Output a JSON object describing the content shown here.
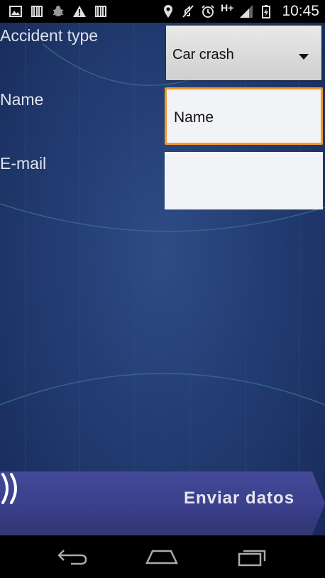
{
  "status_bar": {
    "time": "10:45",
    "network_type": "H+",
    "left_icons": [
      "image-icon",
      "barcode-icon",
      "bug-icon",
      "warning-icon",
      "barcode-icon"
    ],
    "right_icons": [
      "location-icon",
      "mute-icon",
      "alarm-icon",
      "signal-icon",
      "battery-icon"
    ]
  },
  "form": {
    "accident_type_label": "Accident type",
    "accident_type_value": "Car crash",
    "name_label": "Name",
    "name_value": "Name",
    "email_label": "E-mail",
    "email_value": ""
  },
  "send_button": {
    "label": "Enviar datos"
  },
  "nav_bar": {
    "buttons": [
      "back-icon",
      "home-icon",
      "recents-icon"
    ]
  },
  "colors": {
    "background": "#233d73",
    "focus_border": "#f19a2a",
    "send_button": "#3b3f8f"
  }
}
